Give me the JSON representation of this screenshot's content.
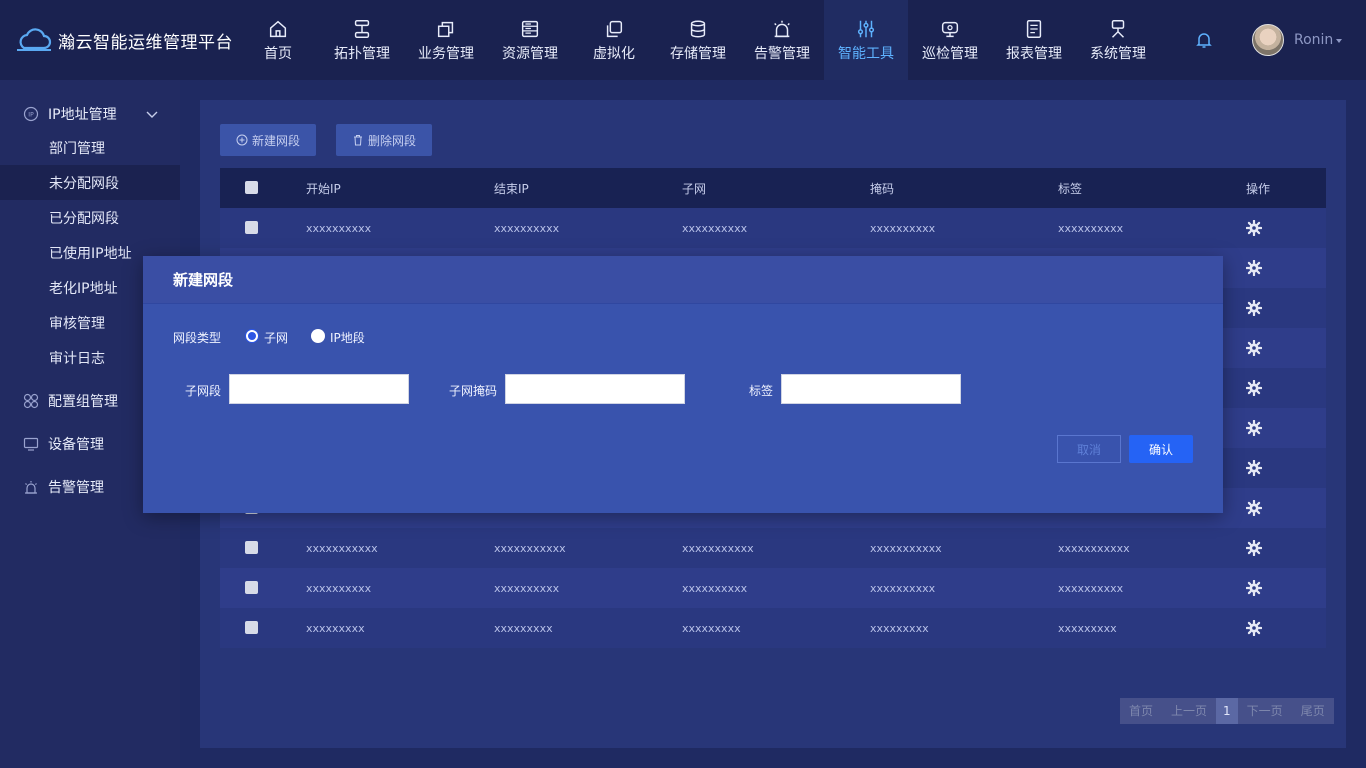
{
  "app": {
    "title": "瀚云智能运维管理平台"
  },
  "nav": [
    {
      "label": "首页",
      "icon": "home-icon"
    },
    {
      "label": "拓扑管理",
      "icon": "topology-icon"
    },
    {
      "label": "业务管理",
      "icon": "business-icon"
    },
    {
      "label": "资源管理",
      "icon": "resource-icon"
    },
    {
      "label": "虚拟化",
      "icon": "virtualization-icon"
    },
    {
      "label": "存储管理",
      "icon": "storage-icon"
    },
    {
      "label": "告警管理",
      "icon": "alarm-icon"
    },
    {
      "label": "智能工具",
      "icon": "tools-icon",
      "active": true
    },
    {
      "label": "巡检管理",
      "icon": "inspection-icon"
    },
    {
      "label": "报表管理",
      "icon": "report-icon"
    },
    {
      "label": "系统管理",
      "icon": "system-icon"
    }
  ],
  "user": {
    "name": "Ronin"
  },
  "sidebar": {
    "ip_group": {
      "label": "IP地址管理",
      "icon": "ip-icon"
    },
    "ip_items": [
      {
        "label": "部门管理"
      },
      {
        "label": "未分配网段",
        "active": true
      },
      {
        "label": "已分配网段"
      },
      {
        "label": "已使用IP地址"
      },
      {
        "label": "老化IP地址"
      },
      {
        "label": "审核管理"
      },
      {
        "label": "审计日志"
      }
    ],
    "groups": [
      {
        "label": "配置组管理",
        "icon": "config-group-icon"
      },
      {
        "label": "设备管理",
        "icon": "device-icon"
      },
      {
        "label": "告警管理",
        "icon": "alarm-icon"
      }
    ]
  },
  "toolbar": {
    "new_label": "新建网段",
    "delete_label": "删除网段"
  },
  "table": {
    "headers": [
      "开始IP",
      "结束IP",
      "子网",
      "掩码",
      "标签",
      "操作"
    ],
    "rows": [
      [
        "xxxxxxxxxx",
        "xxxxxxxxxx",
        "xxxxxxxxxx",
        "xxxxxxxxxx",
        "xxxxxxxxxx"
      ],
      [
        "",
        "",
        "",
        "",
        ""
      ],
      [
        "",
        "",
        "",
        "",
        ""
      ],
      [
        "",
        "",
        "",
        "",
        ""
      ],
      [
        "",
        "",
        "",
        "",
        ""
      ],
      [
        "",
        "",
        "",
        "",
        ""
      ],
      [
        "",
        "",
        "",
        "",
        ""
      ],
      [
        "",
        "",
        "",
        "",
        ""
      ],
      [
        "xxxxxxxxxxx",
        "xxxxxxxxxxx",
        "xxxxxxxxxxx",
        "xxxxxxxxxxx",
        "xxxxxxxxxxx"
      ],
      [
        "xxxxxxxxxx",
        "xxxxxxxxxx",
        "xxxxxxxxxx",
        "xxxxxxxxxx",
        "xxxxxxxxxx"
      ],
      [
        "xxxxxxxxx",
        "xxxxxxxxx",
        "xxxxxxxxx",
        "xxxxxxxxx",
        "xxxxxxxxx"
      ]
    ]
  },
  "pager": {
    "first": "首页",
    "prev": "上一页",
    "page": "1",
    "next": "下一页",
    "last": "尾页"
  },
  "modal": {
    "title": "新建网段",
    "type_label": "网段类型",
    "options": [
      "子网",
      "IP地段"
    ],
    "selected": "子网",
    "subnet_label": "子网段",
    "mask_label": "子网掩码",
    "tag_label": "标签",
    "subnet_value": "",
    "mask_value": "",
    "tag_value": "",
    "cancel": "取消",
    "ok": "确认"
  }
}
